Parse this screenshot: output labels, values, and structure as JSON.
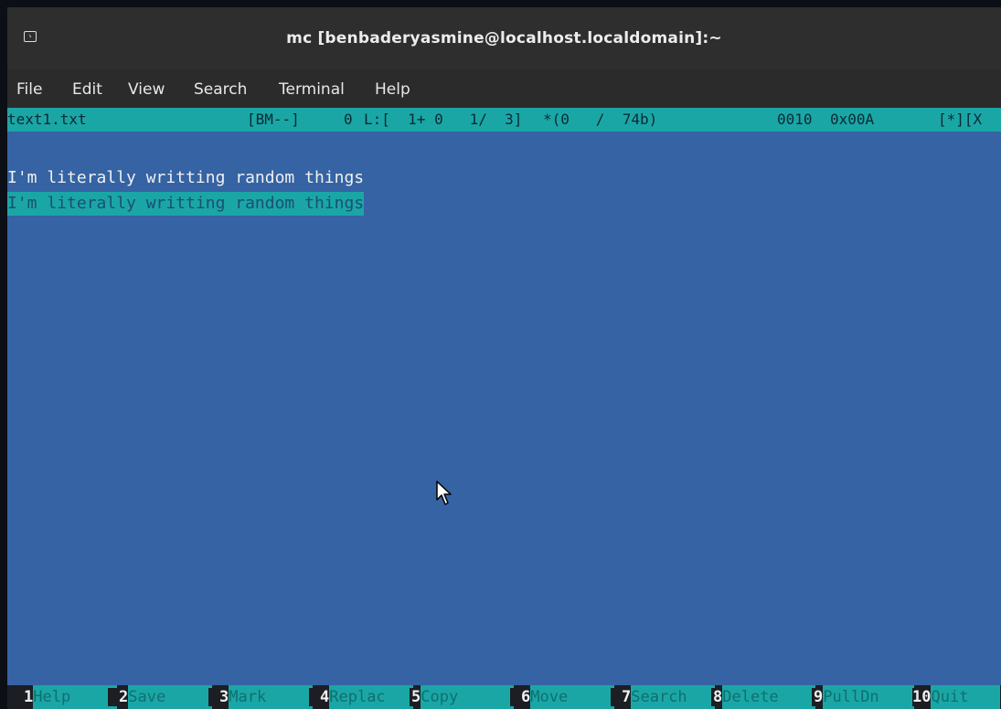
{
  "window": {
    "title": "mc [benbaderyasmine@localhost.localdomain]:~"
  },
  "menu": [
    "File",
    "Edit",
    "View",
    "Search",
    "Terminal",
    "Help"
  ],
  "status": {
    "filename": "text1.txt",
    "flags": "[BM--]",
    "col": "0",
    "line_info": "L:[  1+ 0   1/  3]",
    "offset_info": "*(0   /  74b)",
    "char_code": "0010",
    "hex": "0x00A",
    "tail": "[*][X"
  },
  "editor": {
    "lines": [
      "",
      "I'm literally writting random things",
      "I'm literally writting random things"
    ]
  },
  "function_keys": [
    {
      "num": "1",
      "label": "Help"
    },
    {
      "num": "2",
      "label": "Save"
    },
    {
      "num": "3",
      "label": "Mark"
    },
    {
      "num": "4",
      "label": "Replac"
    },
    {
      "num": "5",
      "label": "Copy"
    },
    {
      "num": "6",
      "label": "Move"
    },
    {
      "num": "7",
      "label": "Search"
    },
    {
      "num": "8",
      "label": "Delete"
    },
    {
      "num": "9",
      "label": "PullDn"
    },
    {
      "num": "10",
      "label": "Quit"
    }
  ],
  "colors": {
    "editor_bg": "#3563a3",
    "status_bg": "#1ba6a6",
    "titlebar_bg": "#2e2e2e",
    "menubar_bg": "#2b2b2b"
  }
}
